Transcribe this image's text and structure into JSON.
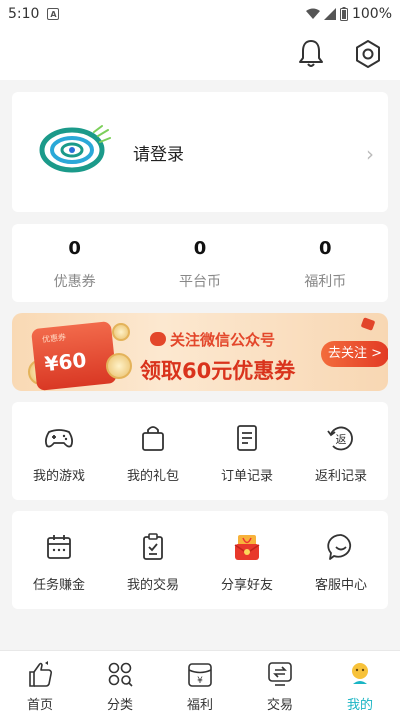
{
  "status_bar": {
    "time": "5:10",
    "notif_letter": "A",
    "battery": "100%"
  },
  "header": {
    "icons": [
      "bell-icon",
      "settings-hex-icon"
    ]
  },
  "login": {
    "label": "请登录"
  },
  "stats": [
    {
      "value": "0",
      "label": "优惠券"
    },
    {
      "value": "0",
      "label": "平台币"
    },
    {
      "value": "0",
      "label": "福利币"
    }
  ],
  "banner": {
    "voucher_tag": "优惠券",
    "voucher_amount": "¥60",
    "line1": "关注微信公众号",
    "line2": "领取60元优惠券",
    "button": "去关注 >"
  },
  "menu1": [
    {
      "label": "我的游戏",
      "icon": "gamepad-icon"
    },
    {
      "label": "我的礼包",
      "icon": "gift-bag-icon"
    },
    {
      "label": "订单记录",
      "icon": "order-doc-icon"
    },
    {
      "label": "返利记录",
      "icon": "rebate-icon"
    }
  ],
  "menu2": [
    {
      "label": "任务赚金",
      "icon": "calendar-icon"
    },
    {
      "label": "我的交易",
      "icon": "clipboard-icon"
    },
    {
      "label": "分享好友",
      "icon": "red-envelope-icon"
    },
    {
      "label": "客服中心",
      "icon": "chat-icon"
    }
  ],
  "tabs": [
    {
      "label": "首页",
      "icon": "thumbs-up-icon"
    },
    {
      "label": "分类",
      "icon": "category-icon"
    },
    {
      "label": "福利",
      "icon": "welfare-icon"
    },
    {
      "label": "交易",
      "icon": "trade-icon"
    },
    {
      "label": "我的",
      "icon": "me-icon"
    }
  ],
  "colors": {
    "accent": "#1ab5c4",
    "banner_red": "#e3472b"
  }
}
